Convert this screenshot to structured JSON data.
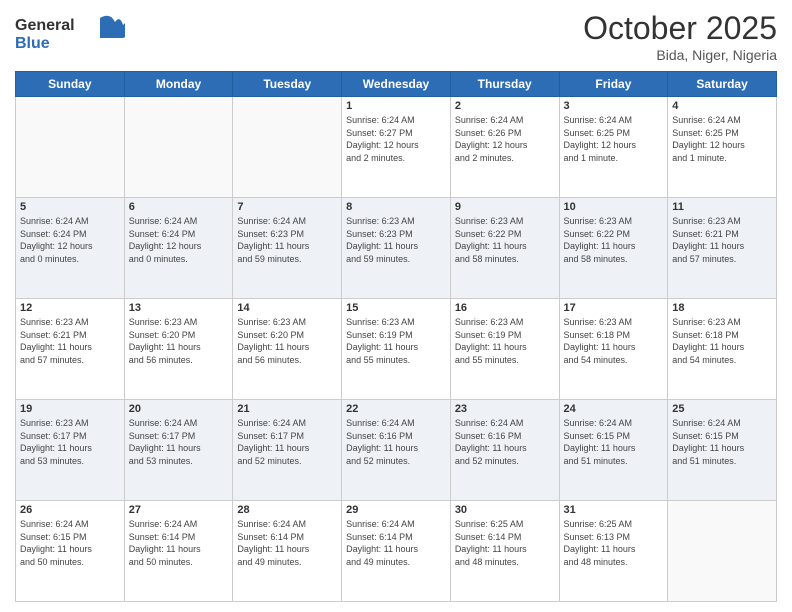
{
  "header": {
    "logo_line1": "General",
    "logo_line2": "Blue",
    "month": "October 2025",
    "location": "Bida, Niger, Nigeria"
  },
  "weekdays": [
    "Sunday",
    "Monday",
    "Tuesday",
    "Wednesday",
    "Thursday",
    "Friday",
    "Saturday"
  ],
  "weeks": [
    [
      {
        "day": "",
        "info": ""
      },
      {
        "day": "",
        "info": ""
      },
      {
        "day": "",
        "info": ""
      },
      {
        "day": "1",
        "info": "Sunrise: 6:24 AM\nSunset: 6:27 PM\nDaylight: 12 hours\nand 2 minutes."
      },
      {
        "day": "2",
        "info": "Sunrise: 6:24 AM\nSunset: 6:26 PM\nDaylight: 12 hours\nand 2 minutes."
      },
      {
        "day": "3",
        "info": "Sunrise: 6:24 AM\nSunset: 6:25 PM\nDaylight: 12 hours\nand 1 minute."
      },
      {
        "day": "4",
        "info": "Sunrise: 6:24 AM\nSunset: 6:25 PM\nDaylight: 12 hours\nand 1 minute."
      }
    ],
    [
      {
        "day": "5",
        "info": "Sunrise: 6:24 AM\nSunset: 6:24 PM\nDaylight: 12 hours\nand 0 minutes."
      },
      {
        "day": "6",
        "info": "Sunrise: 6:24 AM\nSunset: 6:24 PM\nDaylight: 12 hours\nand 0 minutes."
      },
      {
        "day": "7",
        "info": "Sunrise: 6:24 AM\nSunset: 6:23 PM\nDaylight: 11 hours\nand 59 minutes."
      },
      {
        "day": "8",
        "info": "Sunrise: 6:23 AM\nSunset: 6:23 PM\nDaylight: 11 hours\nand 59 minutes."
      },
      {
        "day": "9",
        "info": "Sunrise: 6:23 AM\nSunset: 6:22 PM\nDaylight: 11 hours\nand 58 minutes."
      },
      {
        "day": "10",
        "info": "Sunrise: 6:23 AM\nSunset: 6:22 PM\nDaylight: 11 hours\nand 58 minutes."
      },
      {
        "day": "11",
        "info": "Sunrise: 6:23 AM\nSunset: 6:21 PM\nDaylight: 11 hours\nand 57 minutes."
      }
    ],
    [
      {
        "day": "12",
        "info": "Sunrise: 6:23 AM\nSunset: 6:21 PM\nDaylight: 11 hours\nand 57 minutes."
      },
      {
        "day": "13",
        "info": "Sunrise: 6:23 AM\nSunset: 6:20 PM\nDaylight: 11 hours\nand 56 minutes."
      },
      {
        "day": "14",
        "info": "Sunrise: 6:23 AM\nSunset: 6:20 PM\nDaylight: 11 hours\nand 56 minutes."
      },
      {
        "day": "15",
        "info": "Sunrise: 6:23 AM\nSunset: 6:19 PM\nDaylight: 11 hours\nand 55 minutes."
      },
      {
        "day": "16",
        "info": "Sunrise: 6:23 AM\nSunset: 6:19 PM\nDaylight: 11 hours\nand 55 minutes."
      },
      {
        "day": "17",
        "info": "Sunrise: 6:23 AM\nSunset: 6:18 PM\nDaylight: 11 hours\nand 54 minutes."
      },
      {
        "day": "18",
        "info": "Sunrise: 6:23 AM\nSunset: 6:18 PM\nDaylight: 11 hours\nand 54 minutes."
      }
    ],
    [
      {
        "day": "19",
        "info": "Sunrise: 6:23 AM\nSunset: 6:17 PM\nDaylight: 11 hours\nand 53 minutes."
      },
      {
        "day": "20",
        "info": "Sunrise: 6:24 AM\nSunset: 6:17 PM\nDaylight: 11 hours\nand 53 minutes."
      },
      {
        "day": "21",
        "info": "Sunrise: 6:24 AM\nSunset: 6:17 PM\nDaylight: 11 hours\nand 52 minutes."
      },
      {
        "day": "22",
        "info": "Sunrise: 6:24 AM\nSunset: 6:16 PM\nDaylight: 11 hours\nand 52 minutes."
      },
      {
        "day": "23",
        "info": "Sunrise: 6:24 AM\nSunset: 6:16 PM\nDaylight: 11 hours\nand 52 minutes."
      },
      {
        "day": "24",
        "info": "Sunrise: 6:24 AM\nSunset: 6:15 PM\nDaylight: 11 hours\nand 51 minutes."
      },
      {
        "day": "25",
        "info": "Sunrise: 6:24 AM\nSunset: 6:15 PM\nDaylight: 11 hours\nand 51 minutes."
      }
    ],
    [
      {
        "day": "26",
        "info": "Sunrise: 6:24 AM\nSunset: 6:15 PM\nDaylight: 11 hours\nand 50 minutes."
      },
      {
        "day": "27",
        "info": "Sunrise: 6:24 AM\nSunset: 6:14 PM\nDaylight: 11 hours\nand 50 minutes."
      },
      {
        "day": "28",
        "info": "Sunrise: 6:24 AM\nSunset: 6:14 PM\nDaylight: 11 hours\nand 49 minutes."
      },
      {
        "day": "29",
        "info": "Sunrise: 6:24 AM\nSunset: 6:14 PM\nDaylight: 11 hours\nand 49 minutes."
      },
      {
        "day": "30",
        "info": "Sunrise: 6:25 AM\nSunset: 6:14 PM\nDaylight: 11 hours\nand 48 minutes."
      },
      {
        "day": "31",
        "info": "Sunrise: 6:25 AM\nSunset: 6:13 PM\nDaylight: 11 hours\nand 48 minutes."
      },
      {
        "day": "",
        "info": ""
      }
    ]
  ]
}
